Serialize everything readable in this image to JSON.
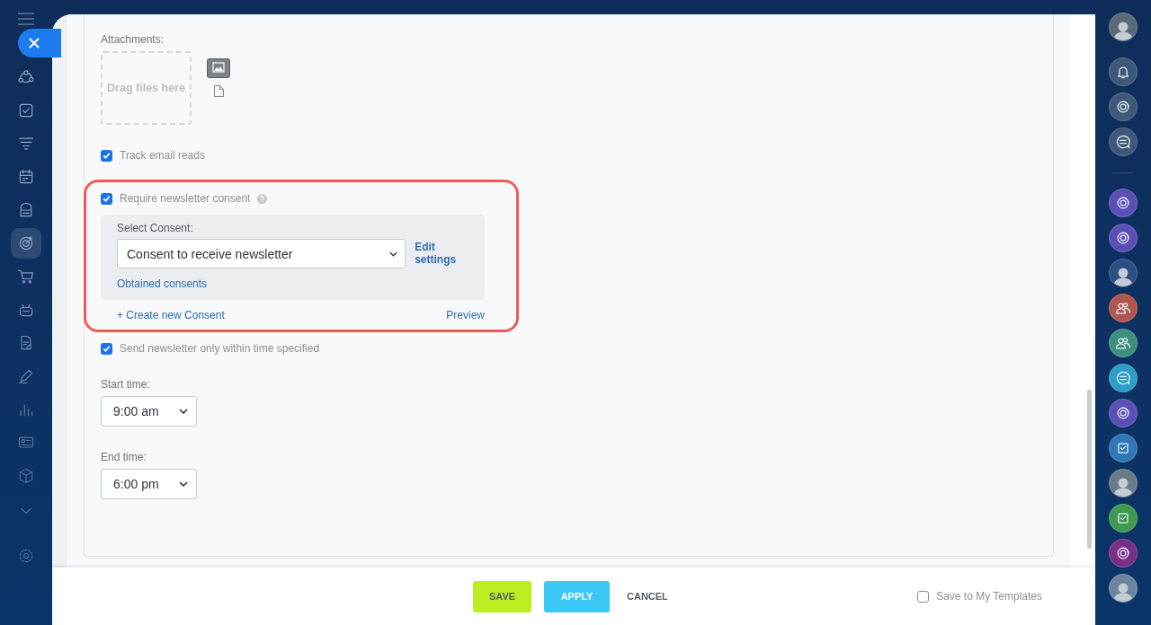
{
  "left_sidebar": {
    "items": [
      {
        "kind": "flow",
        "selected": false
      },
      {
        "kind": "task",
        "selected": false
      },
      {
        "kind": "funnel",
        "selected": false
      },
      {
        "kind": "calendar",
        "selected": false
      },
      {
        "kind": "store",
        "selected": false
      },
      {
        "kind": "target",
        "selected": true
      },
      {
        "kind": "cart",
        "selected": false
      },
      {
        "kind": "robot",
        "selected": false
      },
      {
        "kind": "document",
        "selected": false
      },
      {
        "kind": "pencil",
        "selected": false
      },
      {
        "kind": "chart",
        "selected": false
      },
      {
        "kind": "card",
        "selected": false
      },
      {
        "kind": "box",
        "selected": false
      },
      {
        "kind": "chevron",
        "selected": false
      },
      {
        "kind": "gear",
        "selected": false
      }
    ]
  },
  "form": {
    "attachments": {
      "label": "Attachments:",
      "drop_zone": "Drag files here"
    },
    "track_reads": {
      "label": "Track email reads",
      "checked": true
    },
    "consent": {
      "highlighted": true,
      "label": "Require newsletter consent",
      "checked": true,
      "select_label": "Select Consent:",
      "select_value": "Consent to receive newsletter",
      "edit_link": "Edit settings",
      "obtained_link": "Obtained consents",
      "create_link": "+ Create new Consent",
      "preview_link": "Preview"
    },
    "time_limit": {
      "label": "Send newsletter only within time specified",
      "checked": true
    },
    "start_time": {
      "label": "Start time:",
      "value": "9:00 am"
    },
    "end_time": {
      "label": "End time:",
      "value": "6:00 pm"
    }
  },
  "footer": {
    "save": "SAVE",
    "apply": "APPLY",
    "cancel": "CANCEL",
    "template": {
      "label": "Save to My Templates",
      "checked": false
    }
  },
  "right_sidebar": {
    "items": [
      {
        "kind": "avatar",
        "color": "#5a6a7a"
      },
      {
        "kind": "bell",
        "color": "#3d5878"
      },
      {
        "kind": "spiral",
        "color": "#3d5878"
      },
      {
        "kind": "chat",
        "color": "#3d5878"
      },
      {
        "kind": "divider",
        "color": "#2e4a70"
      },
      {
        "kind": "spiral",
        "color": "#5b4fb5"
      },
      {
        "kind": "spiral",
        "color": "#5b4fb5"
      },
      {
        "kind": "avatar",
        "color": "#2c4f86"
      },
      {
        "kind": "group",
        "color": "#b0564f"
      },
      {
        "kind": "group",
        "color": "#3f8f7f"
      },
      {
        "kind": "chat",
        "color": "#2e9dc7"
      },
      {
        "kind": "spiral",
        "color": "#5b4fb5"
      },
      {
        "kind": "task",
        "color": "#2d78b5"
      },
      {
        "kind": "avatar",
        "color": "#6b7a88"
      },
      {
        "kind": "task",
        "color": "#3f9a50"
      },
      {
        "kind": "spiral",
        "color": "#7a2f86"
      },
      {
        "kind": "avatar",
        "color": "#6c84a0"
      }
    ]
  }
}
